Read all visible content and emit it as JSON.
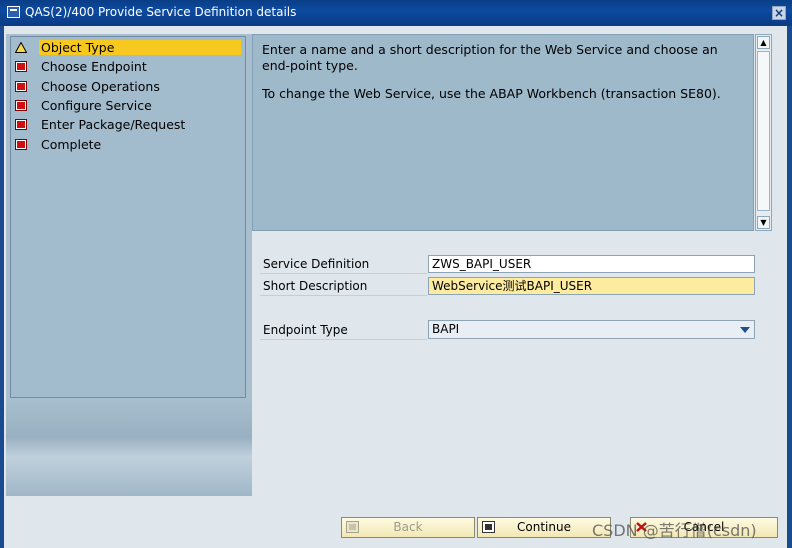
{
  "window": {
    "title": "QAS(2)/400 Provide Service Definition details",
    "close_label": "×"
  },
  "steps": [
    {
      "label": "Object Type",
      "status": "current",
      "icon": "warning-triangle-icon"
    },
    {
      "label": "Choose Endpoint",
      "status": "pending",
      "icon": "red-square-icon"
    },
    {
      "label": "Choose Operations",
      "status": "pending",
      "icon": "red-square-icon"
    },
    {
      "label": "Configure Service",
      "status": "pending",
      "icon": "red-square-icon"
    },
    {
      "label": "Enter Package/Request",
      "status": "pending",
      "icon": "red-square-icon"
    },
    {
      "label": "Complete",
      "status": "pending",
      "icon": "red-square-icon"
    }
  ],
  "info": {
    "line1": "Enter a name and a short description for the Web Service and choose an end-point type.",
    "line2": "To change the Web Service, use the ABAP Workbench (transaction SE80)."
  },
  "form": {
    "service_definition": {
      "label": "Service Definition",
      "value": "ZWS_BAPI_USER"
    },
    "short_description": {
      "label": "Short Description",
      "value": "WebService测试BAPI_USER"
    },
    "endpoint_type": {
      "label": "Endpoint Type",
      "value": "BAPI"
    }
  },
  "buttons": {
    "back": "Back",
    "continue": "Continue",
    "cancel": "Cancel"
  },
  "watermark": "CSDN @苦行僧(csdn)",
  "colors": {
    "titlebar": "#0d4aa0",
    "active_step": "#f6c820",
    "info_panel": "#9eb9ca",
    "focused_input": "#fdeca0"
  }
}
